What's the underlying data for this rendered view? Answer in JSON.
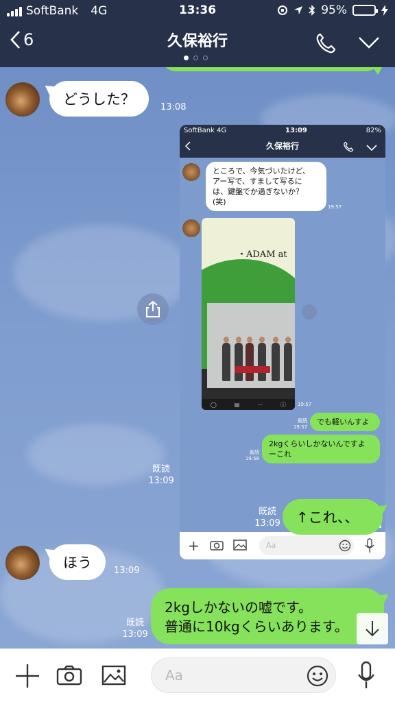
{
  "status": {
    "carrier": "SoftBank",
    "network": "4G",
    "time": "13:36",
    "battery": "95%",
    "battery_level": 0.95
  },
  "header": {
    "back_count": "6",
    "title": "久保裕行",
    "page_dots": 3,
    "active_dot": 0
  },
  "messages": {
    "m1": {
      "text": "どうした？",
      "time": "13:08"
    },
    "m2": {
      "read": "既読",
      "time": "13:09"
    },
    "m3": {
      "text": "↑これ、、",
      "read": "既読",
      "time": "13:09"
    },
    "m4": {
      "text": "ほう",
      "time": "13:09"
    },
    "m5": {
      "line1": "2kgしかないの嘘です。",
      "line2": "普通に10kgくらいあります。",
      "read": "既読",
      "time": "13:09"
    }
  },
  "screenshot": {
    "carrier": "SoftBank",
    "network": "4G",
    "time": "13:09",
    "battery": "82%",
    "title": "久保裕行",
    "msg1_lines": [
      "ところで、今気づいたけど、",
      "アー写で、すまして写るに",
      "は、鍵盤でか過ぎないか？",
      "(笑)"
    ],
    "msg1_time": "19:57",
    "photo_text": "・ADAM at",
    "photo_time": "19:57",
    "msg2": "でも軽いんすよ",
    "msg2_read": "既読",
    "msg2_time": "19:57",
    "msg3_lines": [
      "2kgくらいしかないんですよ",
      "ーこれ"
    ],
    "msg3_read": "既読",
    "msg3_time": "19:58",
    "input_placeholder": "Aa"
  },
  "input": {
    "placeholder": "Aa"
  },
  "colors": {
    "header_bg": "#27324a",
    "bubble_green": "#86e25a",
    "chat_bg": "#7b98c8"
  }
}
